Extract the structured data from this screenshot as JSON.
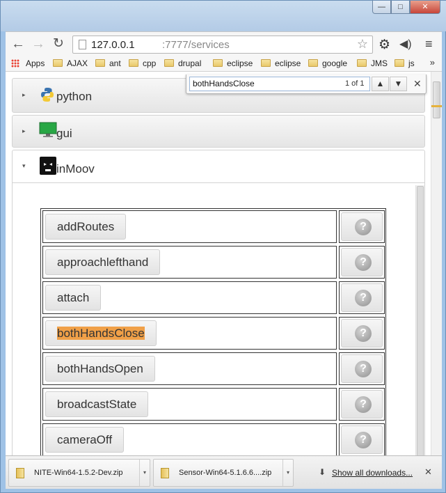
{
  "window": {
    "minimize": "—",
    "maximize": "□",
    "close": "✕"
  },
  "toolbar": {
    "back": "←",
    "forward": "→",
    "reload": "↻",
    "url_host": "127.0.0.1",
    "url_path": ":7777/services",
    "star": "☆",
    "settings": "⚙",
    "sound": "◀)",
    "menu": "≡"
  },
  "bookmarks": {
    "items": [
      "Apps",
      "AJAX",
      "ant",
      "cpp",
      "drupal",
      "eclipse",
      "eclipse",
      "google",
      "JMS",
      "js"
    ],
    "more": "»"
  },
  "find": {
    "query": "bothHandsClose",
    "count": "1 of 1",
    "prev": "▲",
    "next": "▼",
    "close": "✕"
  },
  "panels": {
    "python": {
      "label": "python",
      "arrow": "▸"
    },
    "gui": {
      "label": "gui",
      "arrow": "▸"
    },
    "inmoov": {
      "label": "inMoov",
      "arrow": "▾"
    }
  },
  "methods": [
    {
      "name": "addRoutes"
    },
    {
      "name": "approachlefthand"
    },
    {
      "name": "attach"
    },
    {
      "name": "bothHandsClose",
      "highlighted": true
    },
    {
      "name": "bothHandsOpen"
    },
    {
      "name": "broadcastState"
    },
    {
      "name": "cameraOff"
    }
  ],
  "help_glyph": "?",
  "downloads": {
    "items": [
      "NITE-Win64-1.5.2-Dev.zip",
      "Sensor-Win64-5.1.6.6....zip"
    ],
    "show_all": "Show all downloads...",
    "close": "✕",
    "drop": "▾",
    "arrow": "⬇"
  },
  "colors": {
    "highlight": "#f0a048",
    "frame": "#9fc2e6"
  }
}
